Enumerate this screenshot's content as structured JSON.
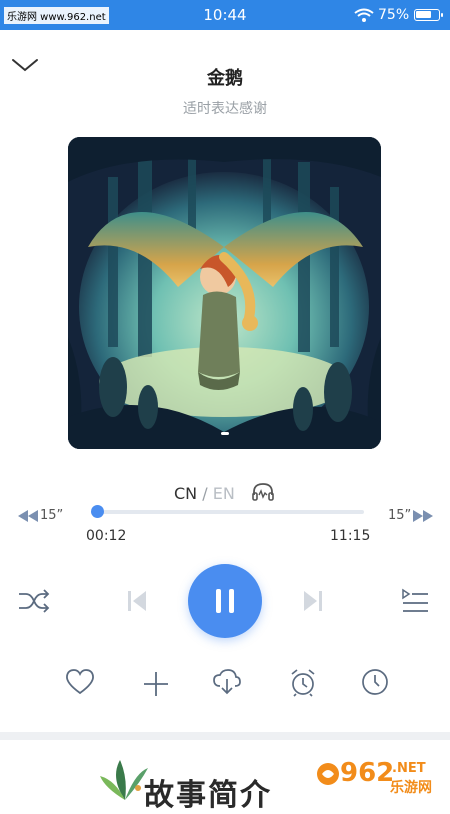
{
  "status_bar": {
    "watermark": "乐游网 www.962.net",
    "time": "10:44",
    "battery_pct": "75%",
    "battery_level": 0.75
  },
  "header": {
    "title": "金鹅",
    "subtitle": "适时表达感谢"
  },
  "cover": {
    "image_icon": "cover-illustration"
  },
  "language": {
    "cn": "CN",
    "separator": "/",
    "en": "EN"
  },
  "progress": {
    "skip_back": "15”",
    "skip_forward": "15”",
    "current": "00:12",
    "duration": "11:15",
    "fraction": 0.018
  },
  "colors": {
    "accent": "#4a8df0",
    "status_bar": "#2f86e6"
  },
  "footer": {
    "intro_title": "故事简介",
    "logo_number": "962",
    "logo_net": ".NET",
    "logo_cn": "乐游网"
  }
}
